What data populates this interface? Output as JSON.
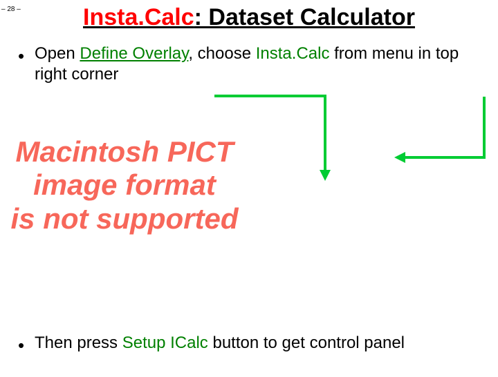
{
  "page_number": "– 28 –",
  "title": {
    "highlight": "Insta.Calc",
    "rest": ": Dataset Calculator"
  },
  "bullet1": {
    "t1": "Open ",
    "link": "Define Overlay",
    "t2": ", choose ",
    "keyword": "Insta.Calc",
    "t3": " from menu in top right corner"
  },
  "placeholder": {
    "line1": "Macintosh PICT",
    "line2": "image format",
    "line3": "is not supported"
  },
  "bullet2": {
    "t1": "Then press ",
    "keyword": "Setup ICalc",
    "t2": " button to get control panel"
  },
  "arrow_color": "#00cc33"
}
